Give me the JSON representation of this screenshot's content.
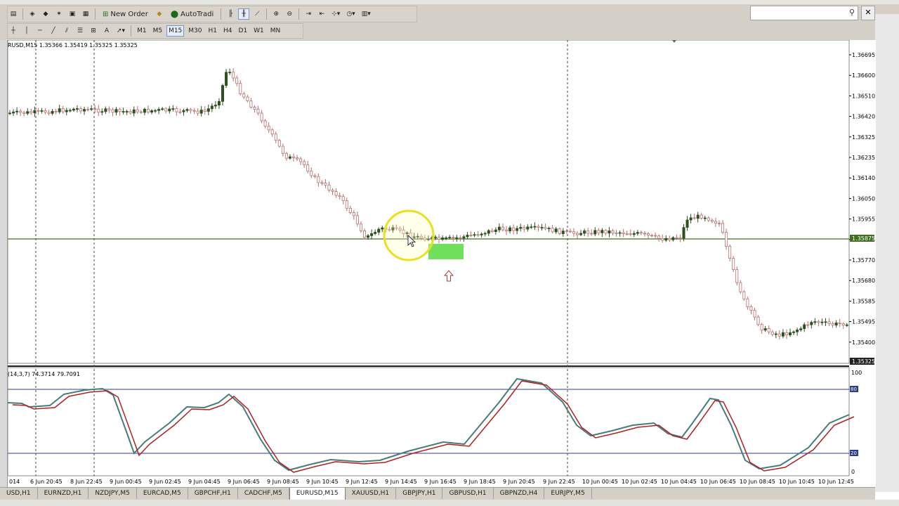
{
  "toolbar": {
    "new_order_label": "New Order",
    "autotrading_label": "AutoTradi",
    "timeframes": [
      "M1",
      "M5",
      "M15",
      "M30",
      "H1",
      "H4",
      "D1",
      "W1",
      "MN"
    ],
    "active_timeframe": "M15",
    "icons": [
      "new-chart-icon",
      "profiles-icon",
      "market-watch-icon",
      "navigator-icon",
      "terminal-icon",
      "tester-icon",
      "new-order-icon",
      "metaeditor-icon",
      "autotrading-icon",
      "bar-chart-icon",
      "candles-icon",
      "line-chart-icon",
      "zoom-in-icon",
      "zoom-out-icon",
      "tile-icon",
      "autoscroll-icon",
      "chart-shift-icon",
      "indicators-icon",
      "periods-icon",
      "templates-icon",
      "cursor-icon",
      "crosshair-icon",
      "vertical-line-icon",
      "horizontal-line-icon",
      "trendline-icon",
      "channel-icon",
      "fibonacci-icon",
      "text-icon",
      "shapes-icon"
    ]
  },
  "search": {
    "placeholder": "",
    "icon": "search-icon"
  },
  "chart": {
    "header": "RUSD,M15  1.35366 1.35419 1.35325 1.35325",
    "price_axis": [
      "1.36695",
      "1.36600",
      "1.36510",
      "1.36420",
      "1.36325",
      "1.36235",
      "1.36140",
      "1.36050",
      "1.35955",
      "1.35865",
      "1.35770",
      "1.35680",
      "1.35585",
      "1.35495",
      "1.35400"
    ],
    "current_price_label": "1.35875",
    "last_price_label": "1.35325",
    "time_axis": [
      "014",
      "6 Jun 20:45",
      "8 Jun 22:45",
      "9 Jun 00:45",
      "9 Jun 02:45",
      "9 Jun 04:45",
      "9 Jun 06:45",
      "9 Jun 08:45",
      "9 Jun 10:45",
      "9 Jun 12:45",
      "9 Jun 14:45",
      "9 Jun 16:45",
      "9 Jun 18:45",
      "9 Jun 20:45",
      "9 Jun 22:45",
      "10 Jun 00:45",
      "10 Jun 02:45",
      "10 Jun 04:45",
      "10 Jun 06:45",
      "10 Jun 08:45",
      "10 Jun 10:45",
      "10 Jun 12:45"
    ],
    "colors": {
      "bull_fill": "#2f4f1f",
      "bear_outline": "#b87070",
      "level_line": "#3f6f1f",
      "highlight_box": "#6ee05a"
    }
  },
  "stochastic": {
    "header": "(14,3,7) 74.3714 79.7091",
    "scale": [
      "100",
      "80",
      "20",
      "0"
    ],
    "levels": [
      80,
      20
    ],
    "colors": {
      "main": "#4a7a7a",
      "signal": "#b02020",
      "level": "#2a3e8c"
    }
  },
  "symbol_tabs": [
    "USD,H1",
    "EURNZD,H1",
    "NZDJPY,M5",
    "EURCAD,M5",
    "GBPCHF,H1",
    "CADCHF,M5",
    "EURUSD,M15",
    "XAUUSD,H1",
    "GBPJPY,H1",
    "GBPUSD,H1",
    "GBPNZD,H4",
    "EURJPY,M5"
  ],
  "active_tab": "EURUSD,M15"
}
